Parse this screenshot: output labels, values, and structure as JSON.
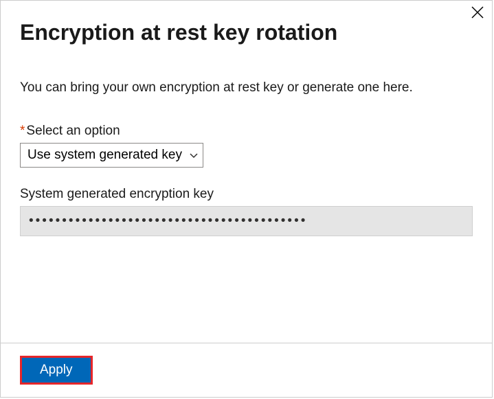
{
  "dialog": {
    "title": "Encryption at rest key rotation",
    "description": "You can bring your own encryption at rest key or generate one here.",
    "option_label": "Select an option",
    "option_value": "Use system generated key",
    "key_label": "System generated encryption key",
    "key_value": "••••••••••••••••••••••••••••••••••••••••••",
    "apply_label": "Apply"
  }
}
